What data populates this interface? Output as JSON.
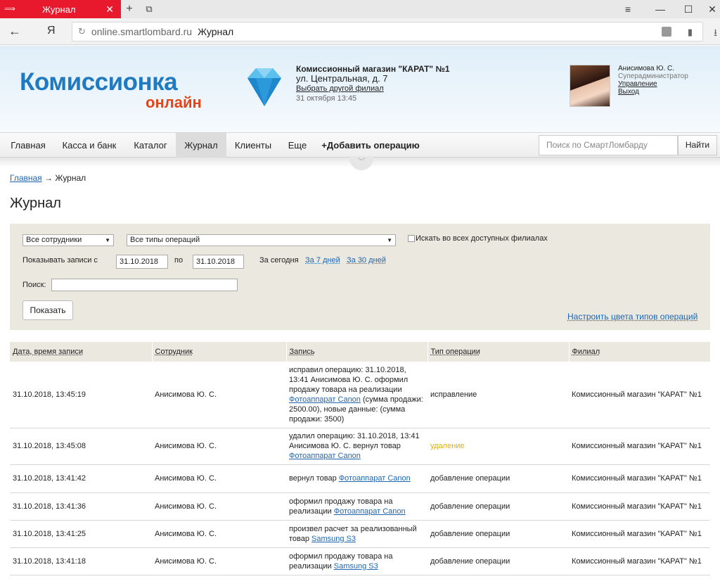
{
  "browser": {
    "tab_title": "Журнал",
    "url_host": "online.smartlombard.ru",
    "url_title": "Журнал",
    "ya_label": "Я"
  },
  "header": {
    "logo_main": "Комиссионка",
    "logo_sub": "онлайн",
    "shop_name": "Комиссионный магазин \"КАРАТ\" №1",
    "shop_address": "ул. Центральная, д. 7",
    "shop_switch": "Выбрать другой филиал",
    "shop_date": "31 октября 13:45",
    "user_name": "Анисимова Ю. С.",
    "user_role": "Суперадминистратор",
    "user_manage": "Управление",
    "user_logout": "Выход"
  },
  "menu": {
    "items": [
      "Главная",
      "Касса и банк",
      "Каталог",
      "Журнал",
      "Клиенты",
      "Еще",
      "+Добавить операцию"
    ],
    "search_placeholder": "Поиск по СмартЛомбарду",
    "search_button": "Найти"
  },
  "breadcrumb": {
    "home": "Главная",
    "arrow": "→",
    "current": "Журнал"
  },
  "page_title": "Журнал",
  "filter": {
    "employees_select": "Все сотрудники",
    "types_select": "Все типы операций",
    "all_branches_label": "Искать во всех доступных филиалах",
    "show_records_label": "Показывать записи с",
    "date_from": "31.10.2018",
    "to_label": "по",
    "date_to": "31.10.2018",
    "today_label": "За сегодня",
    "week_link": "За 7 дней",
    "month_link": "За 30 дней",
    "search_label": "Поиск:",
    "search_value": "",
    "show_button": "Показать",
    "colors_link": "Настроить цвета типов операций"
  },
  "table": {
    "headers": [
      "Дата, время записи",
      "Сотрудник",
      "Запись",
      "Тип операции",
      "Филиал"
    ],
    "rows": [
      {
        "datetime": "31.10.2018, 13:45:19",
        "employee": "Анисимова Ю. С.",
        "record_pre": "исправил операцию: 31.10.2018, 13:41 Анисимова Ю. С. оформил продажу товара на реализации ",
        "record_link": "Фотоаппарат Canon",
        "record_post": " (сумма продажи: 2500.00), новые данные: (сумма продажи: 3500)",
        "type": "исправление",
        "branch": "Комиссионный магазин \"КАРАТ\" №1"
      },
      {
        "datetime": "31.10.2018, 13:45:08",
        "employee": "Анисимова Ю. С.",
        "record_pre": "удалил операцию: 31.10.2018, 13:41 Анисимова Ю. С. вернул товар ",
        "record_link": "Фотоаппарат Canon",
        "record_post": "",
        "type": "удаление",
        "branch": "Комиссионный магазин \"КАРАТ\" №1"
      },
      {
        "datetime": "31.10.2018, 13:41:42",
        "employee": "Анисимова Ю. С.",
        "record_pre": "вернул товар ",
        "record_link": "Фотоаппарат Canon",
        "record_post": "",
        "type": "добавление операции",
        "branch": "Комиссионный магазин \"КАРАТ\" №1"
      },
      {
        "datetime": "31.10.2018, 13:41:36",
        "employee": "Анисимова Ю. С.",
        "record_pre": "оформил продажу товара на реализации ",
        "record_link": "Фотоаппарат Canon",
        "record_post": "",
        "type": "добавление операции",
        "branch": "Комиссионный магазин \"КАРАТ\" №1"
      },
      {
        "datetime": "31.10.2018, 13:41:25",
        "employee": "Анисимова Ю. С.",
        "record_pre": "произвел расчет за реализованный товар ",
        "record_link": "Samsung S3",
        "record_post": "",
        "type": "добавление операции",
        "branch": "Комиссионный магазин \"КАРАТ\" №1"
      },
      {
        "datetime": "31.10.2018, 13:41:18",
        "employee": "Анисимова Ю. С.",
        "record_pre": "оформил продажу товара на реализации ",
        "record_link": "Samsung S3",
        "record_post": "",
        "type": "добавление операции",
        "branch": "Комиссионный магазин \"КАРАТ\" №1"
      }
    ]
  },
  "colors": {
    "brand_blue": "#1f7ac0",
    "brand_orange": "#e0451c",
    "tab_red": "#e8192c",
    "delete_type": "#e0b000",
    "link": "#1f66b0"
  }
}
